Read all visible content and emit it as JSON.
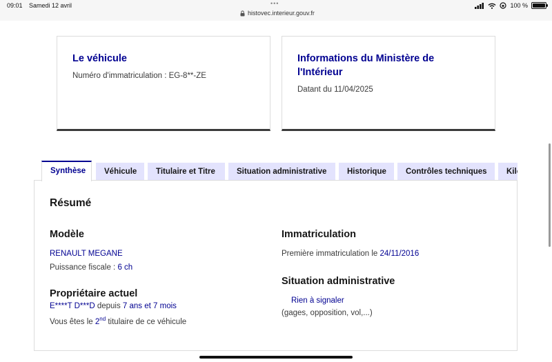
{
  "status": {
    "time": "09:01",
    "date": "Samedi 12 avril",
    "url": "histovec.interieur.gouv.fr",
    "battery": "100 %",
    "battery_level": 1.0
  },
  "cards": {
    "vehicle": {
      "title": "Le véhicule",
      "label": "Numéro d'immatriculation : ",
      "value": "EG-8**-ZE"
    },
    "ministry": {
      "title": "Informations du Ministère de l'Intérieur",
      "text": "Datant du 11/04/2025"
    }
  },
  "tabs": [
    {
      "label": "Synthèse",
      "active": true
    },
    {
      "label": "Véhicule",
      "active": false
    },
    {
      "label": "Titulaire et Titre",
      "active": false
    },
    {
      "label": "Situation administrative",
      "active": false
    },
    {
      "label": "Historique",
      "active": false
    },
    {
      "label": "Contrôles techniques",
      "active": false
    },
    {
      "label": "Kilo",
      "active": false
    }
  ],
  "summary": {
    "title": "Résumé",
    "model": {
      "heading": "Modèle",
      "name": "RENAULT MEGANE",
      "power_label": "Puissance fiscale : ",
      "power_value": "6 ch"
    },
    "owner": {
      "heading": "Propriétaire actuel",
      "name": "E****T D***D",
      "since_label": " depuis ",
      "since_value": "7 ans et 7 mois",
      "line_prefix": "Vous êtes le ",
      "rank_num": "2",
      "rank_sup": "nd",
      "line_suffix": " titulaire de ce véhicule"
    },
    "registration": {
      "heading": "Immatriculation",
      "label": "Première immatriculation le ",
      "value": "24/11/2016"
    },
    "admin": {
      "heading": "Situation administrative",
      "status": "Rien à signaler",
      "details": "(gages, opposition, vol,...)"
    }
  }
}
